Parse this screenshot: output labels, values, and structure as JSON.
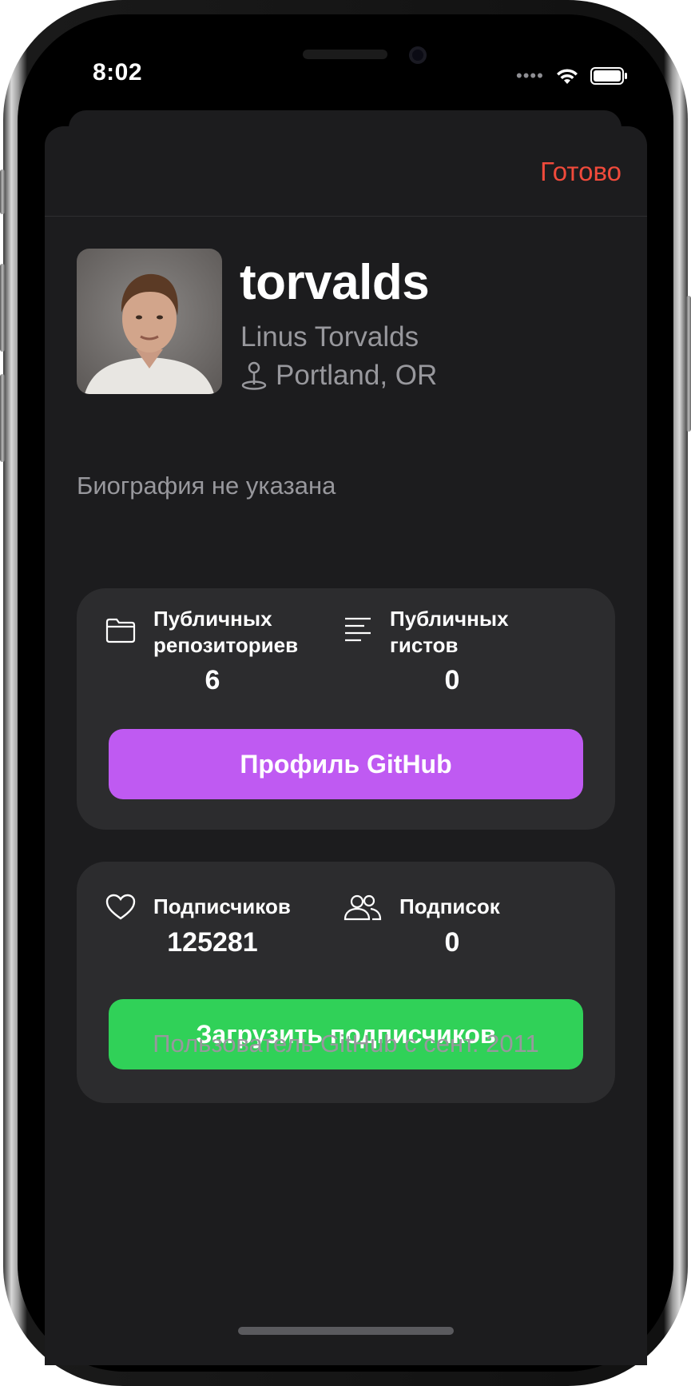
{
  "status_bar": {
    "time": "8:02"
  },
  "navbar": {
    "done_label": "Готово"
  },
  "profile": {
    "username": "torvalds",
    "full_name": "Linus Torvalds",
    "location": "Portland, OR",
    "bio": "Биография не указана"
  },
  "repos_card": {
    "public_repos_label": "Публичных репозиториев",
    "public_repos_value": "6",
    "public_gists_label": "Публичных гистов",
    "public_gists_value": "0",
    "button_label": "Профиль GitHub"
  },
  "followers_card": {
    "followers_label": "Подписчиков",
    "followers_value": "125281",
    "following_label": "Подписок",
    "following_value": "0",
    "button_label": "Загрузить подписчиков"
  },
  "footer": {
    "member_since": "Пользователь GitHub с сент. 2011"
  },
  "icons": [
    "wifi-icon",
    "battery-icon",
    "location-pin-icon",
    "folder-icon",
    "text-lines-icon",
    "heart-icon",
    "people-icon"
  ],
  "colors": {
    "accent_red": "#f04a3b",
    "purple": "#bf5af2",
    "green": "#30d158",
    "card": "#2c2c2e",
    "sheet": "#1c1c1e"
  }
}
